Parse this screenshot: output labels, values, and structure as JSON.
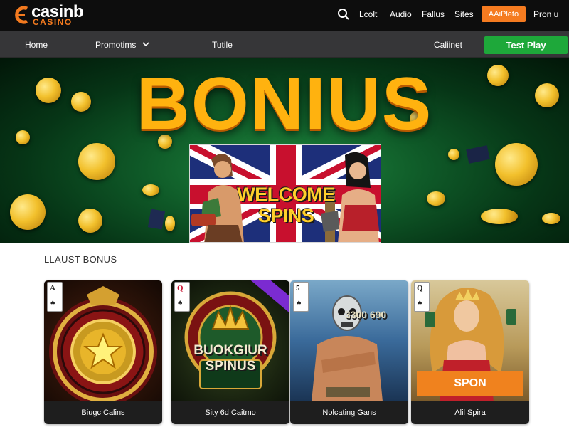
{
  "header": {
    "logo_text": "casinb",
    "logo_sub": "CASINO",
    "links": [
      "Lcolt",
      "Audio",
      "Fallus",
      "Sites"
    ],
    "cta_label": "AAiPleto",
    "last_link": "Pron u",
    "search_icon": "search-icon"
  },
  "nav": {
    "items": [
      "Home",
      "Promotims",
      "Tutile",
      "Caliinet"
    ],
    "chevron_icon": "chevron-down-icon",
    "cta_label": "Test Play"
  },
  "hero": {
    "title": "BONIUS",
    "panel_line1": "WELCOME",
    "panel_line2": "SPINS"
  },
  "bonus_section": {
    "title": "LLAUST BONUS",
    "cards": [
      {
        "rank": "A",
        "suit": "♠",
        "art_label": "",
        "caption": "Biugc Calins"
      },
      {
        "rank": "Q",
        "suit": "♠",
        "art_label": "BUOKGIUR SPINUS",
        "caption": "Sity 6d Caitmo"
      },
      {
        "rank": "5",
        "suit": "♠",
        "art_label": "3300 690",
        "caption": "Nolcating Gans"
      },
      {
        "rank": "Q",
        "suit": "♠",
        "art_label": "SPON",
        "caption": "Alil Spira"
      }
    ]
  },
  "colors": {
    "topbar": "#0d0d0d",
    "navbar": "#363638",
    "accent_orange": "#f57b20",
    "accent_green": "#1ea83a",
    "hero_gold": "#ffb20f"
  }
}
